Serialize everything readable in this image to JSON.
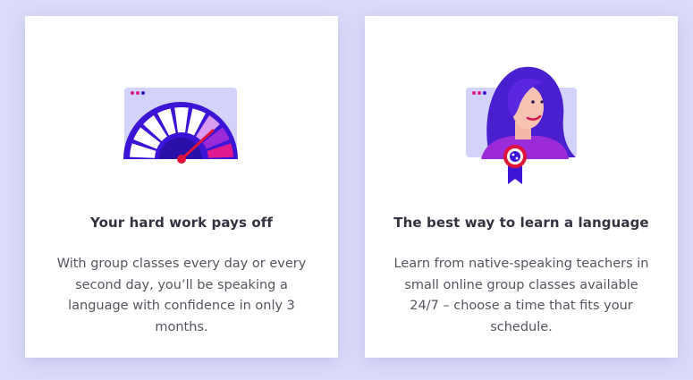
{
  "cards": [
    {
      "title": "Your hard work pays off",
      "text": "With group classes every day or every second day, you’ll be speaking a language with confidence in only 3 months.",
      "illustration": "speedometer-icon"
    },
    {
      "title": "The best way to learn a language",
      "text": "Learn from native-speaking teachers in small online group classes available 24/7 – choose a time that fits your schedule.",
      "illustration": "teacher-award-icon"
    }
  ],
  "colors": {
    "background": "#dcdcf8",
    "browser_window": "#d2d2fb",
    "dial": "#3b14d6",
    "accent_pink": "#e0198e",
    "accent_purple": "#9b2bd8",
    "needle": "#e0123c",
    "hair": "#4a1fd0",
    "badge_ring": "#e0123c",
    "ribbon": "#3b14d6"
  }
}
